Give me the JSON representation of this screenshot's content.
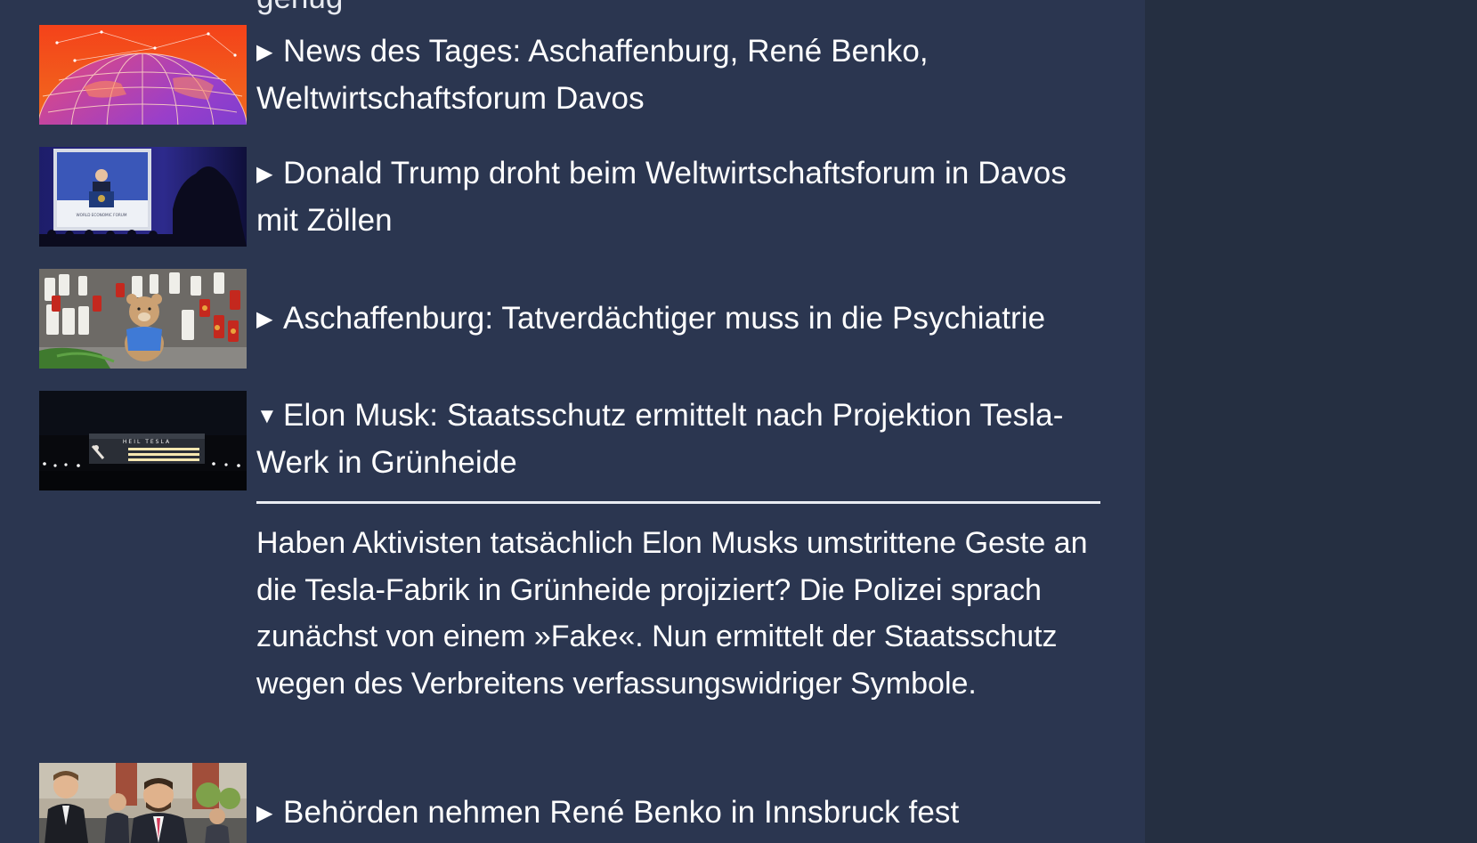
{
  "feed": {
    "cut_text": "genug",
    "items": [
      {
        "arrow": "▶",
        "title": "News des Tages: Aschaffenburg, René Benko, Weltwirtschaftsforum Davos"
      },
      {
        "arrow": "▶",
        "title": "Donald Trump droht beim Weltwirtschaftsforum in Davos mit Zöllen"
      },
      {
        "arrow": "▶",
        "title": "Aschaffenburg: Tatverdächtiger muss in die Psychiatrie"
      },
      {
        "arrow": "▼",
        "title": "Elon Musk: Staatsschutz ermittelt nach Projektion Tesla-Werk in Grünheide"
      },
      {
        "arrow": "▶",
        "title": "Behörden nehmen René Benko in Innsbruck fest"
      }
    ],
    "expanded_teaser": "Haben Aktivisten tatsächlich Elon Musks umstrittene Geste an die Tesla-Fabrik in Grünheide projiziert? Die Polizei sprach zunächst von einem »Fake«. Nun ermittelt der Staatsschutz wegen des Verbreitens verfassungswidriger Symbole.",
    "thumb_podium_sign": "WORLD ECONOMIC FORUM",
    "thumb_building_sign": "HEIL TESLA"
  },
  "colors": {
    "feed_background": "#2b3650",
    "sidebar_background": "#252f41",
    "text": "#ffffff"
  }
}
